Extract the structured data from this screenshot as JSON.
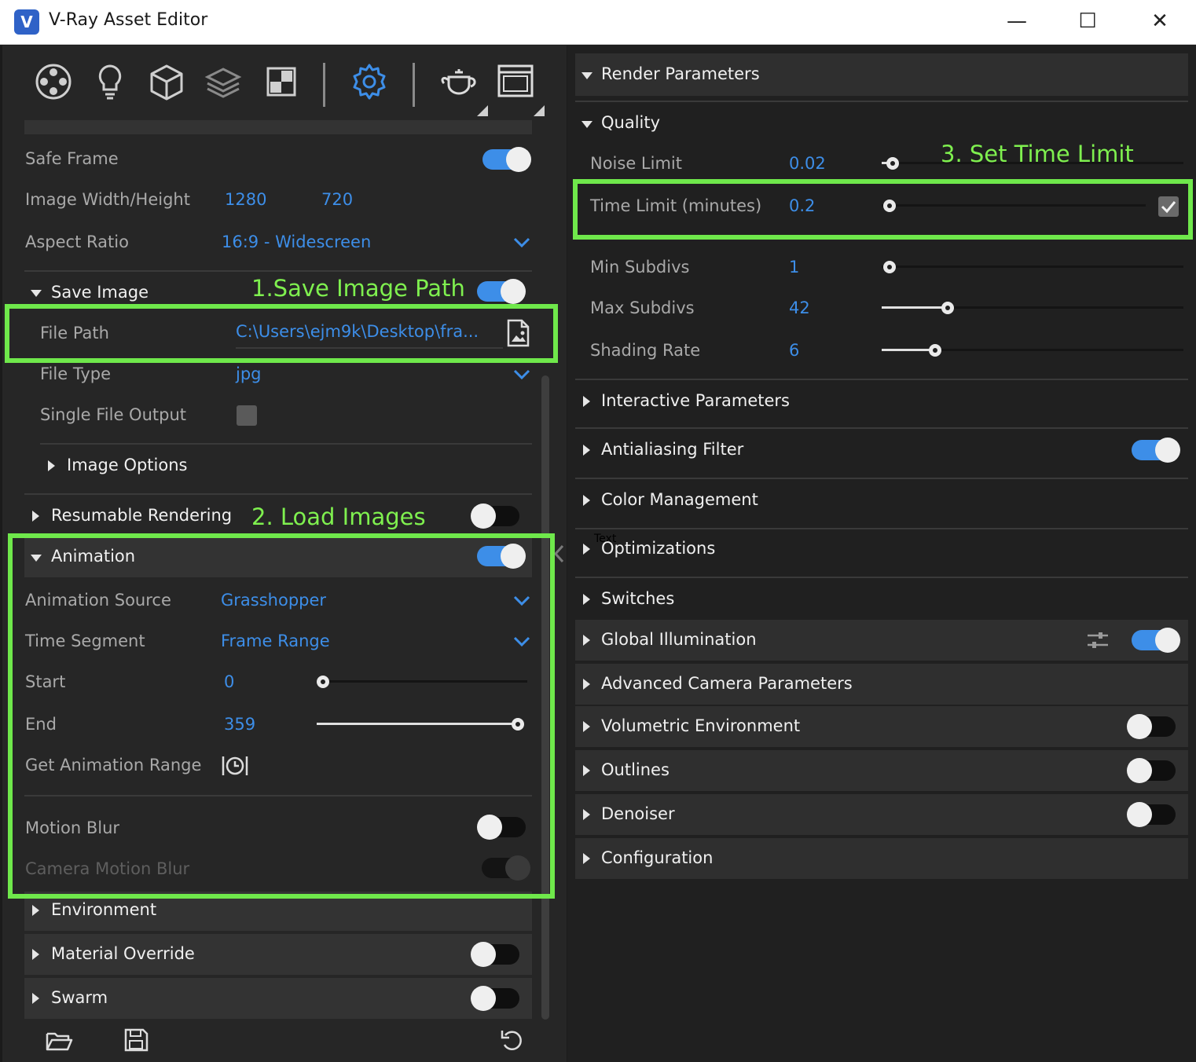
{
  "window": {
    "title": "V-Ray Asset Editor",
    "logo": "V",
    "minimize": "—",
    "maximize": "☐",
    "close": "✕"
  },
  "toolbar": {
    "icons": [
      "materials-icon",
      "lights-icon",
      "geometry-icon",
      "layers-icon",
      "textures-icon",
      "settings-icon",
      "render-teapot-icon",
      "frame-buffer-icon"
    ]
  },
  "left": {
    "safe_frame": "Safe Frame",
    "image_wh_label": "Image Width/Height",
    "image_width": "1280",
    "image_height": "720",
    "aspect_ratio_label": "Aspect Ratio",
    "aspect_ratio_value": "16:9 - Widescreen",
    "save_image": "Save Image",
    "file_path_label": "File Path",
    "file_path_value": "C:\\Users\\ejm9k\\Desktop\\fra...",
    "file_type_label": "File Type",
    "file_type_value": "jpg",
    "single_file_output": "Single File Output",
    "image_options": "Image Options",
    "resumable_rendering": "Resumable Rendering",
    "animation": "Animation",
    "animation_source_label": "Animation Source",
    "animation_source_value": "Grasshopper",
    "time_segment_label": "Time Segment",
    "time_segment_value": "Frame Range",
    "start_label": "Start",
    "start_value": "0",
    "end_label": "End",
    "end_value": "359",
    "get_animation_range": "Get Animation Range",
    "motion_blur": "Motion Blur",
    "camera_motion_blur": "Camera Motion Blur",
    "environment": "Environment",
    "material_override": "Material Override",
    "swarm": "Swarm"
  },
  "annotations": {
    "save_image_path": "1.Save Image Path",
    "load_images": "2. Load Images",
    "set_time_limit": "3. Set Time Limit"
  },
  "right": {
    "render_parameters": "Render Parameters",
    "quality": "Quality",
    "noise_limit_label": "Noise Limit",
    "noise_limit_value": "0.02",
    "time_limit_label": "Time Limit (minutes)",
    "time_limit_value": "0.2",
    "min_subdivs_label": "Min Subdivs",
    "min_subdivs_value": "1",
    "max_subdivs_label": "Max Subdivs",
    "max_subdivs_value": "42",
    "shading_rate_label": "Shading Rate",
    "shading_rate_value": "6",
    "interactive_parameters": "Interactive Parameters",
    "antialiasing_filter": "Antialiasing Filter",
    "color_management": "Color Management",
    "text_overlay": "Text",
    "optimizations": "Optimizations",
    "switches": "Switches",
    "global_illumination": "Global Illumination",
    "advanced_camera_parameters": "Advanced Camera Parameters",
    "volumetric_environment": "Volumetric Environment",
    "outlines": "Outlines",
    "denoiser": "Denoiser",
    "configuration": "Configuration"
  },
  "colors": {
    "accent": "#3d8ee8",
    "annotation": "#6fe84b"
  }
}
